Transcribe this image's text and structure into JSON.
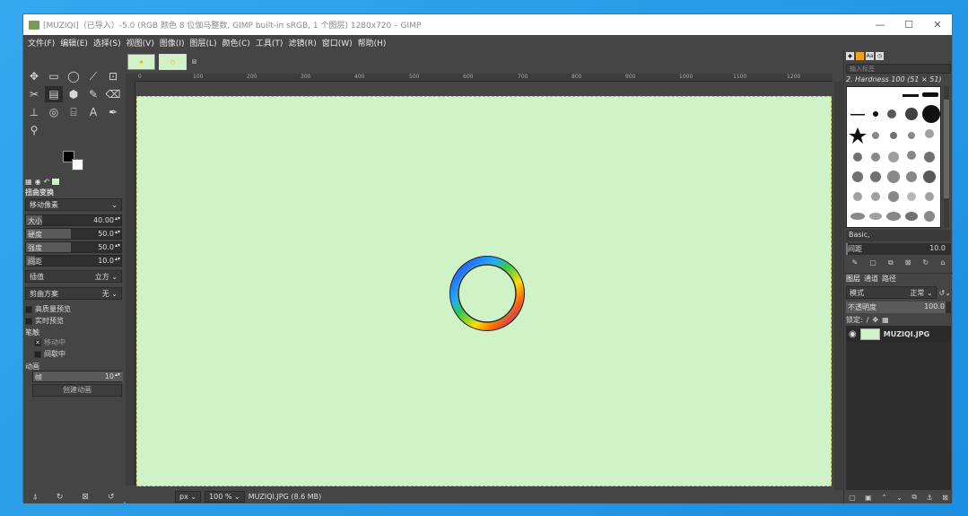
{
  "window": {
    "title": "[MUZIQI]（已导入）-5.0 (RGB 颜色 8 位伽马整数, GIMP built-in sRGB, 1 个图层) 1280x720 – GIMP",
    "minimize": "—",
    "maximize": "☐",
    "close": "✕"
  },
  "menu": [
    "文件(F)",
    "编辑(E)",
    "选择(S)",
    "视图(V)",
    "图像(I)",
    "图层(L)",
    "颜色(C)",
    "工具(T)",
    "滤镜(R)",
    "窗口(W)",
    "帮助(H)"
  ],
  "toolbox": {
    "tools": [
      "✥",
      "▭",
      "◯",
      "⟋",
      "⊡",
      "✂",
      "▤",
      "⬢",
      "✎",
      "⌫",
      "⊥",
      "◎",
      "⌸",
      "A",
      "✒",
      "⚲"
    ],
    "options_title": "扭曲变换",
    "mode": "移动像素",
    "size_label": "大小",
    "size_value": "40.00",
    "hardness_label": "硬度",
    "hardness_value": "50.0",
    "strength_label": "强度",
    "strength_value": "50.0",
    "spacing_label": "间距",
    "spacing_value": "10.0",
    "interpolation_label": "插值",
    "interpolation_value": "立方",
    "clip_label": "剪曲方案",
    "clip_value": "无",
    "hq_preview": "高质量预览",
    "realtime_preview": "实时预览",
    "stroke_section": "笔触",
    "during_motion": "移动中",
    "periodically": "间歇中",
    "animation_section": "动画",
    "frames_label": "帧",
    "frames_value": "10",
    "create_animation": "创建动画"
  },
  "canvas": {
    "ruler_ticks": [
      "0",
      "100",
      "200",
      "300",
      "400",
      "500",
      "600",
      "700",
      "800",
      "900",
      "1000",
      "1100",
      "1200"
    ],
    "bg_color": "#cff2c6",
    "unit": "px",
    "zoom": "100 %",
    "file_info": "MUZIQI.JPG (8.6 MB)"
  },
  "dock": {
    "brush_filter": "输入标签",
    "brush_name": "2. Hardness 100 (51 × 51)",
    "brush_preset": "Basic,",
    "spacing_label": "间距",
    "spacing_value": "10.0",
    "tabs": [
      "图层",
      "通道",
      "路径"
    ],
    "mode_label": "模式",
    "mode_value": "正常",
    "opacity_label": "不透明度",
    "opacity_value": "100.0",
    "lock_label": "锁定:",
    "layer_name": "MUZIQI.JPG"
  }
}
